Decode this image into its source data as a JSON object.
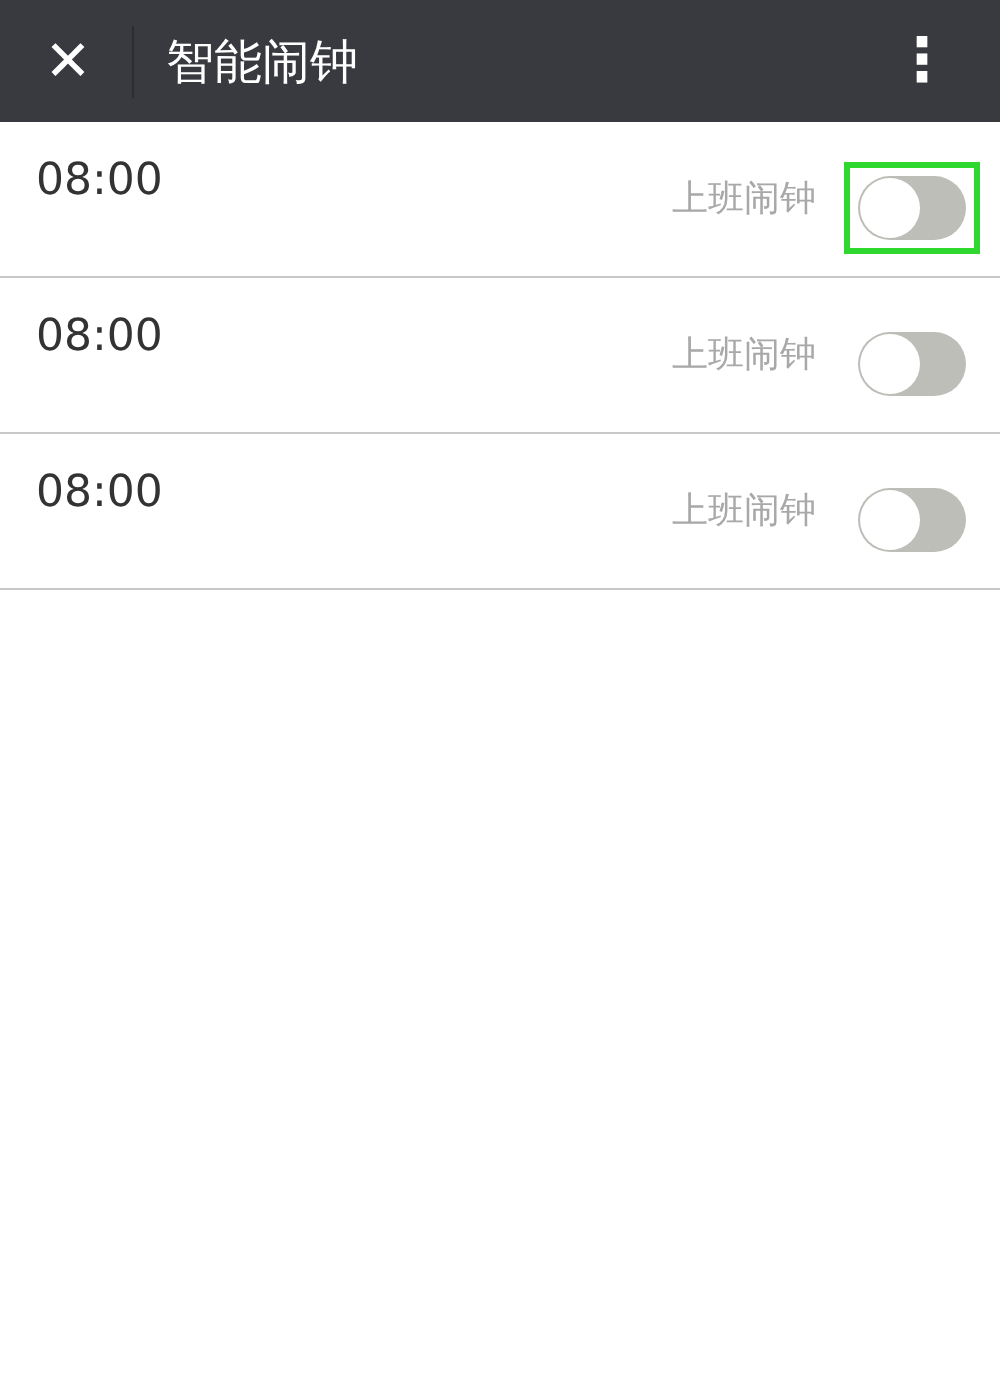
{
  "header": {
    "close_icon": "✕",
    "title": "智能闹钟",
    "menu_icon": "⋮"
  },
  "alarms": [
    {
      "time": "08:00",
      "label": "上班闹钟",
      "on": false,
      "highlighted": true
    },
    {
      "time": "08:00",
      "label": "上班闹钟",
      "on": false,
      "highlighted": false
    },
    {
      "time": "08:00",
      "label": "上班闹钟",
      "on": false,
      "highlighted": false
    }
  ]
}
